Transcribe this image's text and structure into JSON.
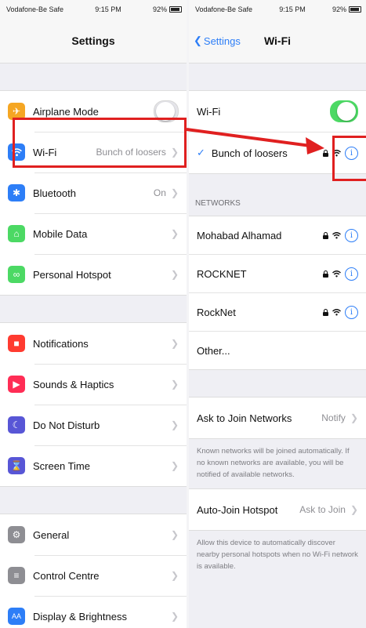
{
  "left": {
    "status": {
      "carrier": "Vodafone-Be Safe",
      "time": "9:15 PM",
      "battery": "92%"
    },
    "title": "Settings",
    "groups": [
      [
        {
          "label": "Airplane Mode",
          "value": "",
          "icon": "airplane-icon",
          "color": "#f5a623"
        },
        {
          "label": "Wi-Fi",
          "value": "Bunch of loosers",
          "icon": "wifi-icon",
          "color": "#2d7ef7"
        },
        {
          "label": "Bluetooth",
          "value": "On",
          "icon": "bluetooth-icon",
          "color": "#2d7ef7"
        },
        {
          "label": "Mobile Data",
          "value": "",
          "icon": "antenna-icon",
          "color": "#4cd964"
        },
        {
          "label": "Personal Hotspot",
          "value": "",
          "icon": "hotspot-icon",
          "color": "#4cd964"
        }
      ],
      [
        {
          "label": "Notifications",
          "value": "",
          "icon": "notifications-icon",
          "color": "#ff3b30"
        },
        {
          "label": "Sounds & Haptics",
          "value": "",
          "icon": "speaker-icon",
          "color": "#ff2d55"
        },
        {
          "label": "Do Not Disturb",
          "value": "",
          "icon": "moon-icon",
          "color": "#5856d6"
        },
        {
          "label": "Screen Time",
          "value": "",
          "icon": "hourglass-icon",
          "color": "#5856d6"
        }
      ],
      [
        {
          "label": "General",
          "value": "",
          "icon": "gear-icon",
          "color": "#8e8e93"
        },
        {
          "label": "Control Centre",
          "value": "",
          "icon": "switches-icon",
          "color": "#8e8e93"
        },
        {
          "label": "Display & Brightness",
          "value": "",
          "icon": "display-icon",
          "color": "#2d7ef7"
        }
      ]
    ]
  },
  "right": {
    "status": {
      "carrier": "Vodafone-Be Safe",
      "time": "9:15 PM",
      "battery": "92%"
    },
    "back_label": "Settings",
    "title": "Wi-Fi",
    "wifi_label": "Wi-Fi",
    "connected_network": "Bunch of loosers",
    "networks_header": "NETWORKS",
    "networks": [
      "Mohabad Alhamad",
      "ROCKNET",
      "RockNet"
    ],
    "other_label": "Other...",
    "ask_label": "Ask to Join Networks",
    "ask_value": "Notify",
    "ask_footer": "Known networks will be joined automatically. If no known networks are available, you will be notified of available networks.",
    "auto_join_label": "Auto-Join Hotspot",
    "auto_join_value": "Ask to Join",
    "auto_join_footer": "Allow this device to automatically discover nearby personal hotspots when no Wi-Fi network is available."
  },
  "colors": {
    "highlight": "#e02020",
    "accent": "#2d7ef7",
    "toggle_on": "#4cd964"
  }
}
